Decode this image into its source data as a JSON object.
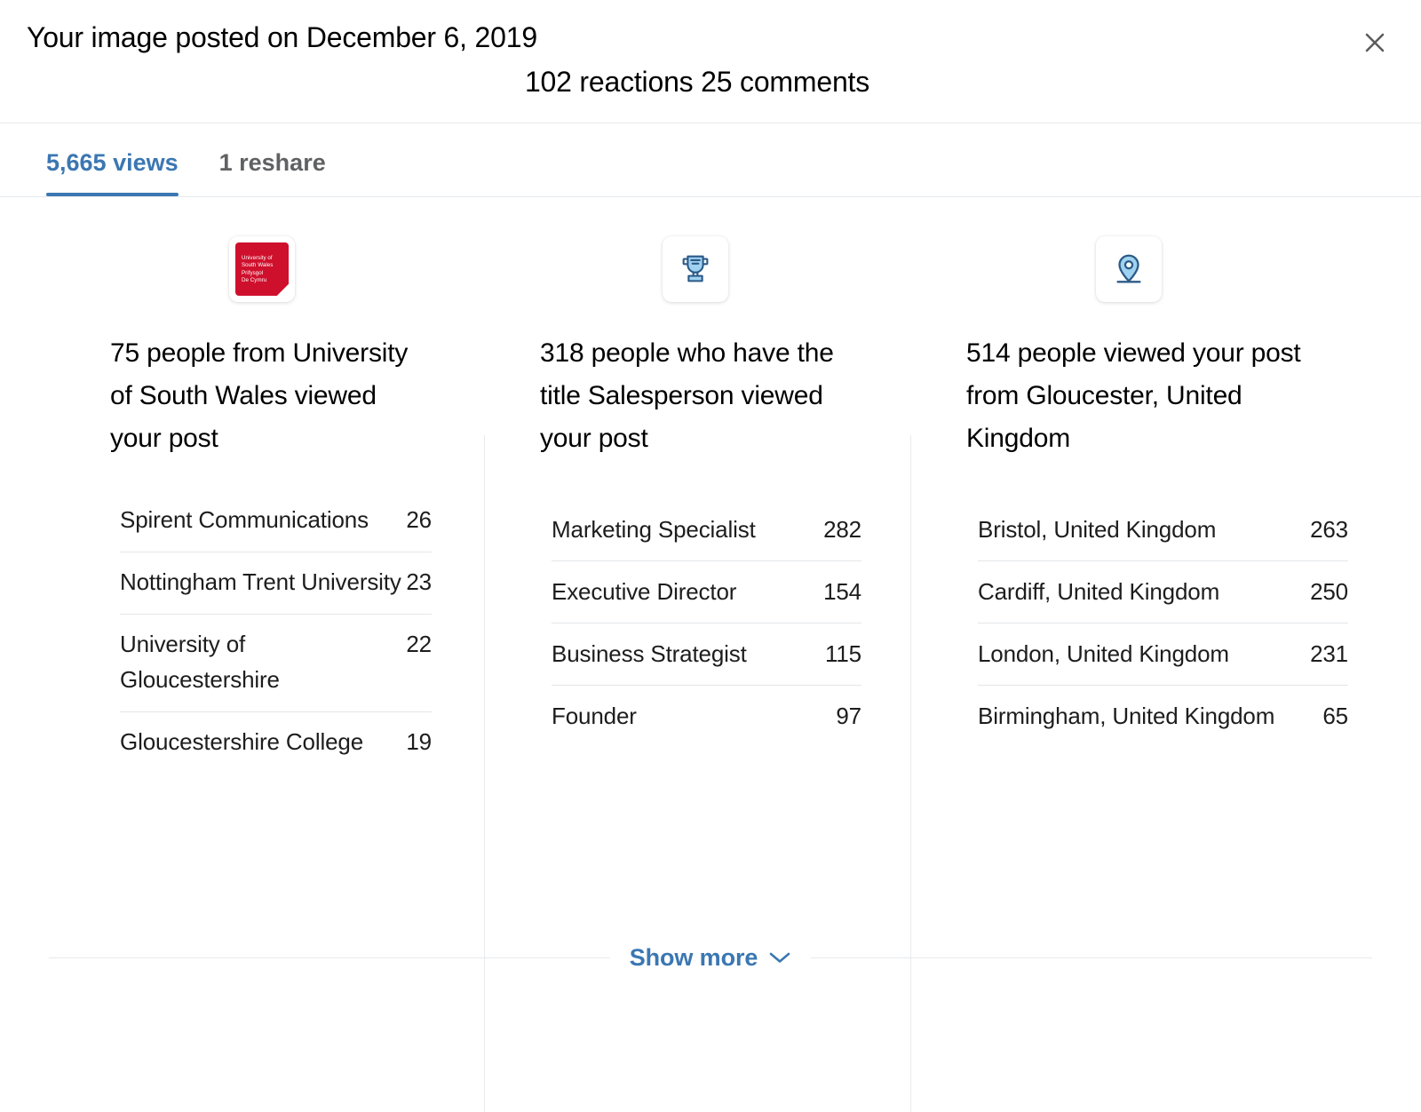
{
  "header": {
    "title": "Your image posted on December 6, 2019",
    "subtitle": "102 reactions 25 comments",
    "close_label": "close-icon"
  },
  "tabs": [
    {
      "label": "5,665 views",
      "active": true
    },
    {
      "label": "1 reshare",
      "active": false
    }
  ],
  "colors": {
    "accent": "#3b77b2",
    "logo_red": "#cf102d",
    "icon_stroke": "#2b5a87",
    "icon_fill": "#9fd2f0",
    "divider": "#e6e9ec",
    "muted_text": "#5f6163"
  },
  "columns": [
    {
      "icon": "university-of-south-wales-logo",
      "logo_lines": [
        "University of",
        "South Wales",
        "Prifysgol",
        "De Cymru"
      ],
      "heading": "75 people from University of South Wales viewed your post",
      "rows": [
        {
          "label": "Spirent Communications",
          "value": "26"
        },
        {
          "label": "Nottingham Trent University",
          "value": "23"
        },
        {
          "label": "University of Gloucestershire",
          "value": "22"
        },
        {
          "label": "Gloucestershire College",
          "value": "19"
        }
      ]
    },
    {
      "icon": "trophy-icon",
      "heading": "318 people who have the title Salesperson viewed your post",
      "rows": [
        {
          "label": "Marketing Specialist",
          "value": "282"
        },
        {
          "label": "Executive Director",
          "value": "154"
        },
        {
          "label": "Business Strategist",
          "value": "115"
        },
        {
          "label": "Founder",
          "value": "97"
        }
      ]
    },
    {
      "icon": "location-pin-icon",
      "heading": "514 people viewed your post from Gloucester, United Kingdom",
      "rows": [
        {
          "label": "Bristol, United Kingdom",
          "value": "263"
        },
        {
          "label": "Cardiff, United Kingdom",
          "value": "250"
        },
        {
          "label": "London, United Kingdom",
          "value": "231"
        },
        {
          "label": "Birmingham, United Kingdom",
          "value": "65"
        }
      ]
    }
  ],
  "footer": {
    "show_more_label": "Show more",
    "chevron": "chevron-down-icon"
  }
}
